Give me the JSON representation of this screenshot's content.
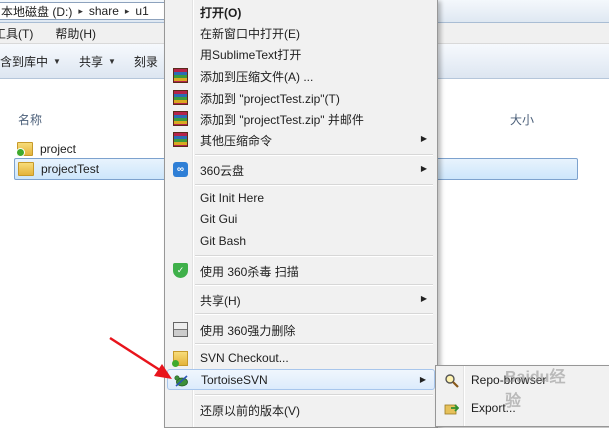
{
  "address": {
    "drive": "本地磁盘 (D:)",
    "folder1": "share",
    "folder2": "u1",
    "separator": "▸"
  },
  "menubar": {
    "tools": "工具(T)",
    "help": "帮助(H)"
  },
  "toolbar": {
    "include_library": "包含到库中",
    "share": "共享",
    "burn": "刻录",
    "dropdown_arrow": "▼"
  },
  "columns": {
    "name": "名称",
    "size": "大小"
  },
  "files": [
    {
      "name": "project",
      "icon": "svn-folder-icon"
    },
    {
      "name": "projectTest",
      "icon": "folder-icon",
      "selected": true
    }
  ],
  "context_menu": {
    "items": [
      {
        "label": "打开(O)",
        "bold": true
      },
      {
        "label": "在新窗口中打开(E)"
      },
      {
        "label": "用SublimeText打开"
      },
      {
        "label": "添加到压缩文件(A) ...",
        "icon": "winrar-icon"
      },
      {
        "label": "添加到 \"projectTest.zip\"(T)",
        "icon": "winrar-icon"
      },
      {
        "label": "添加到 \"projectTest.zip\" 并邮件",
        "icon": "winrar-icon"
      },
      {
        "label": "其他压缩命令",
        "icon": "winrar-icon",
        "submenu": true
      },
      {
        "label": "360云盘",
        "icon": "cloud-360-icon",
        "submenu": true
      },
      {
        "label": "Git Init Here"
      },
      {
        "label": "Git Gui"
      },
      {
        "label": "Git Bash"
      },
      {
        "label": "使用 360杀毒 扫描",
        "icon": "shield-360-icon"
      },
      {
        "label": "共享(H)",
        "submenu": true
      },
      {
        "label": "使用 360强力删除",
        "icon": "shredder-icon"
      },
      {
        "label": "SVN Checkout...",
        "icon": "svn-checkout-icon"
      },
      {
        "label": "TortoiseSVN",
        "icon": "tortoisesvn-icon",
        "submenu": true,
        "hover": true
      },
      {
        "label": "还原以前的版本(V)"
      }
    ],
    "submenu_arrow": "▶"
  },
  "tortoise_submenu": {
    "items": [
      {
        "label": "Repo-browser",
        "icon": "repo-browser-icon"
      },
      {
        "label": "Export...",
        "icon": "export-icon"
      }
    ]
  },
  "watermark": "Baidu经验",
  "colors": {
    "arrow": "#e8141c",
    "hover_border": "#a8c6ec",
    "selection_border": "#7da2ce"
  }
}
